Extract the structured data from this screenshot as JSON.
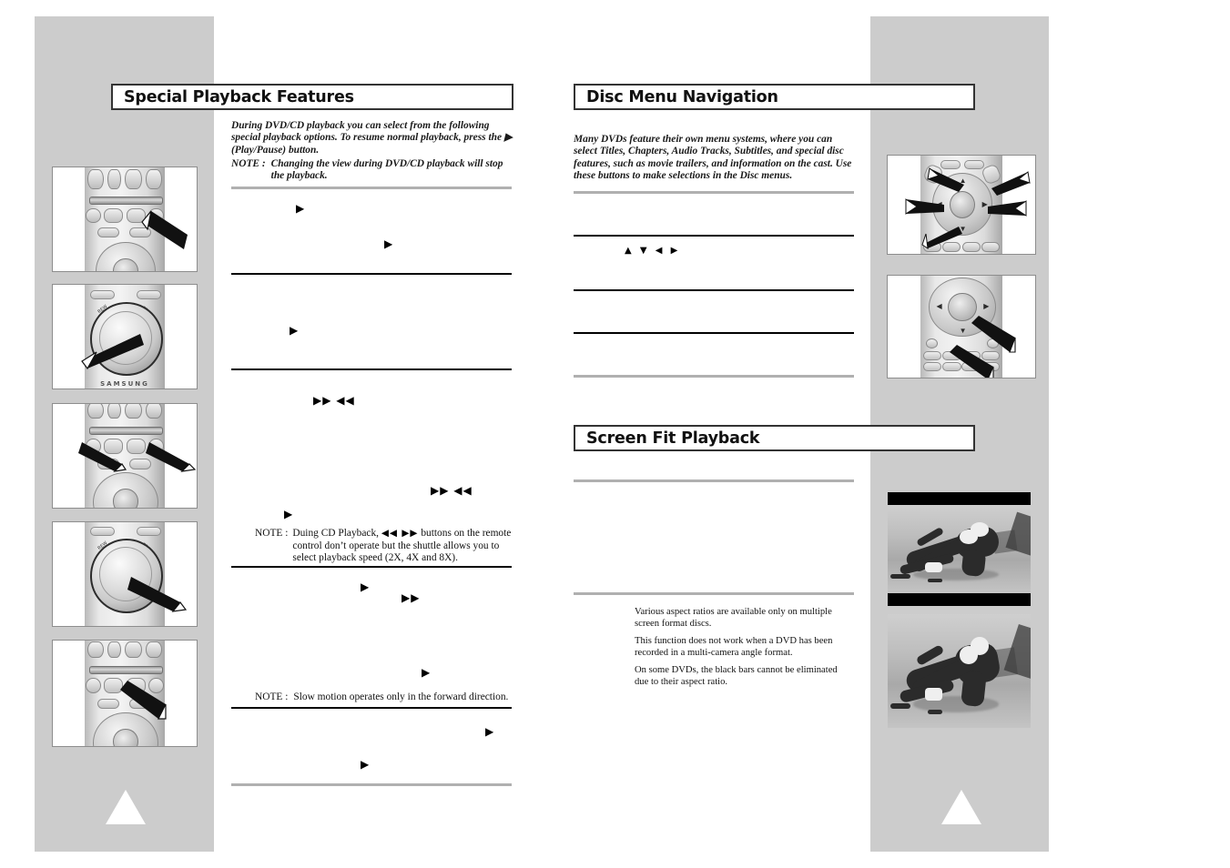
{
  "page": {
    "background": "#ffffff",
    "panel_color": "#cccccc",
    "rule_gray": "#b0b0b0",
    "rule_black": "#000000"
  },
  "sections": {
    "special_playback": {
      "title": "Special Playback Features",
      "intro": "During DVD/CD playback you can select from the following special playback options. To resume normal playback, press the ▶ (Play/Pause) button.",
      "note_label": "NOTE :",
      "note_text": "Changing the view during DVD/CD playback will stop the playback.",
      "glyphs": {
        "play_1": "▶",
        "play_2": "▶",
        "play_3": "▶",
        "ff_rew_1": "▶▶  ◀◀",
        "ff_rew_2": "▶▶ ◀◀",
        "play_4": "▶",
        "play_5": "▶",
        "ff_1": "▶▶",
        "play_6": "▶",
        "play_7": "▶",
        "play_8": "▶"
      },
      "note_cd_label": "NOTE :",
      "note_cd_text_a": "Duing CD Playback, ",
      "note_cd_glyph": "◀◀ ▶▶",
      "note_cd_text_b": " buttons on the remote control don’t operate but the shuttle allows you to select playback speed (2X, 4X and 8X).",
      "note_slow_label": "NOTE :",
      "note_slow_text": "Slow motion operates only in the forward direction."
    },
    "disc_menu_navigation": {
      "title": "Disc Menu Navigation",
      "intro": "Many DVDs feature their own menu systems, where you can select Titles, Chapters, Audio Tracks, Subtitles, and special disc features, such as movie trailers, and information on the cast. Use these buttons to make selections in the Disc menus.",
      "nav_glyphs": "▲ ▼  ◀ ▶"
    },
    "screen_fit_playback": {
      "title": "Screen Fit Playback",
      "bullets": [
        "Various aspect ratios are available only on multiple screen format discs.",
        "This function does not work when a DVD has been recorded in a multi-camera angle format.",
        "On some DVDs, the black bars cannot be eliminated due to their aspect ratio."
      ]
    }
  },
  "figures": {
    "remote_left": [
      {
        "name": "remote-transport-playpause",
        "caption": ""
      },
      {
        "name": "remote-shuttle-dial-left",
        "caption": ""
      },
      {
        "name": "remote-transport-skip",
        "caption": ""
      },
      {
        "name": "remote-shuttle-dial-right",
        "caption": ""
      },
      {
        "name": "remote-transport-step",
        "caption": ""
      }
    ],
    "remote_right": [
      {
        "name": "remote-dpad-directions",
        "caption": ""
      },
      {
        "name": "remote-dpad-enter-menu",
        "caption": ""
      }
    ],
    "screen_samples": [
      {
        "name": "skater-letterboxed",
        "caption": ""
      },
      {
        "name": "skater-screen-fit",
        "caption": ""
      }
    ],
    "brand_text": "SAMSUNG"
  }
}
